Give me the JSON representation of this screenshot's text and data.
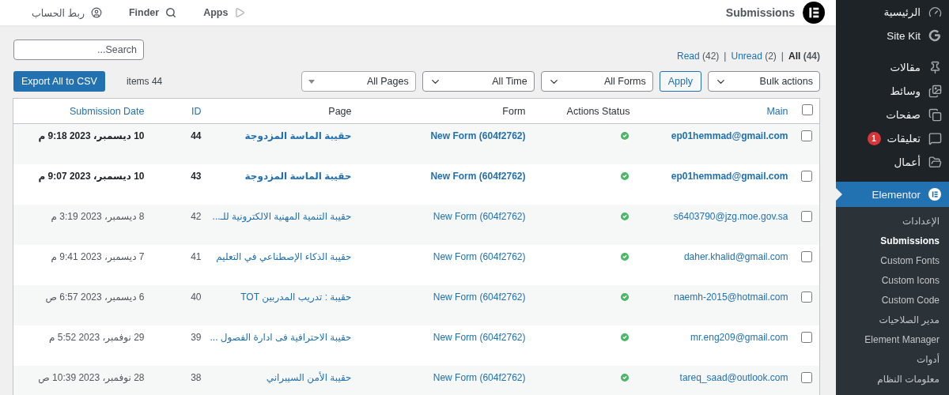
{
  "topbar": {
    "title": "Submissions",
    "links": [
      {
        "label": "Apps"
      },
      {
        "label": "Finder"
      },
      {
        "label": "ربط الحساب"
      }
    ]
  },
  "search": {
    "placeholder": "Search..."
  },
  "views": [
    {
      "label": "All",
      "count": "(44)",
      "selected": true
    },
    {
      "separator": "|",
      "label": "Unread",
      "count": "(2)",
      "selected": false
    },
    {
      "separator": "|",
      "label": "Read",
      "count": "(42)",
      "selected": false
    }
  ],
  "toolbar": {
    "filters": [
      {
        "label": "Bulk actions",
        "kind": "select"
      },
      {
        "label": "All Forms",
        "kind": "select"
      },
      {
        "label": "All Time",
        "kind": "select"
      },
      {
        "label": "All Pages",
        "kind": "combo"
      }
    ],
    "apply": "Apply",
    "items_count": "items 44",
    "export": "Export All to CSV"
  },
  "table": {
    "header_checked": false,
    "columns": [
      {
        "label": "Main",
        "sortable": true
      },
      {
        "label": "Actions Status",
        "sortable": false
      },
      {
        "label": "Form",
        "sortable": false
      },
      {
        "label": "Page",
        "sortable": false
      },
      {
        "label": "ID",
        "sortable": true
      },
      {
        "label": "Submission Date",
        "sortable": true
      }
    ],
    "rows": [
      {
        "checked": false,
        "unread": true,
        "main": "ep01hemmad@gmail.com",
        "status_ok": true,
        "form": "New Form (604f2762)",
        "page": "حقيبة الماسة المزدوجة",
        "id": "44",
        "date": "10 ديسمبر، 2023 9:18 م"
      },
      {
        "checked": false,
        "unread": true,
        "main": "ep01hemmad@gmail.com",
        "status_ok": true,
        "form": "New Form (604f2762)",
        "page": "حقيبة الماسة المزدوجة",
        "id": "43",
        "date": "10 ديسمبر، 2023 9:07 م"
      },
      {
        "checked": false,
        "unread": false,
        "main": "s6403790@jzg.moe.gov.sa",
        "status_ok": true,
        "form": "New Form (604f2762)",
        "page": "حقيبة التنمية المهنية الالكترونية للـ...",
        "id": "42",
        "date": "8 ديسمبر، 2023 3:19 م"
      },
      {
        "checked": false,
        "unread": false,
        "main": "daher.khalid@gmail.com",
        "status_ok": true,
        "form": "New Form (604f2762)",
        "page": "حقيبة الذكاء الإصطناعي في التعليم",
        "id": "41",
        "date": "7 ديسمبر، 2023 9:41 م"
      },
      {
        "checked": false,
        "unread": false,
        "main": "naemh-2015@hotmail.com",
        "status_ok": true,
        "form": "New Form (604f2762)",
        "page": "حقيبة : تدريب المدربين TOT",
        "id": "40",
        "date": "6 ديسمبر، 2023 6:57 ص"
      },
      {
        "checked": false,
        "unread": false,
        "main": "mr.eng209@gmail.com",
        "status_ok": true,
        "form": "New Form (604f2762)",
        "page": "حقيبة الاحترافية فى ادارة الفصول ...",
        "id": "39",
        "date": "29 نوفمبر، 2023 5:52 م"
      },
      {
        "checked": false,
        "unread": false,
        "main": "tareq_saad@outlook.com",
        "status_ok": true,
        "form": "New Form (604f2762)",
        "page": "حقيبة الأمن السيبراني",
        "id": "38",
        "date": "28 نوفمبر، 2023 10:39 ص"
      }
    ]
  },
  "sidebar": {
    "groups": [
      {
        "items": [
          {
            "label": "الرئيسية",
            "selected": false
          },
          {
            "label": "Site Kit",
            "selected": false
          }
        ]
      },
      {
        "items": [
          {
            "label": "مقالات",
            "selected": false
          },
          {
            "label": "وسائط",
            "selected": false
          },
          {
            "label": "صفحات",
            "selected": false
          },
          {
            "label": "تعليقات",
            "selected": false,
            "badge": "1"
          },
          {
            "label": "أعمال",
            "selected": false
          }
        ]
      },
      {
        "items": [
          {
            "label": "Elementor",
            "selected": true,
            "children": [
              {
                "label": "الإعدادات",
                "selected": false
              },
              {
                "label": "Submissions",
                "selected": true
              },
              {
                "label": "Custom Fonts",
                "selected": false
              },
              {
                "label": "Custom Icons",
                "selected": false
              },
              {
                "label": "Custom Code",
                "selected": false
              },
              {
                "label": "مدير الصلاحيات",
                "selected": false
              },
              {
                "label": "Element Manager",
                "selected": false
              },
              {
                "label": "أدوات",
                "selected": false
              },
              {
                "label": "معلومات النظام",
                "selected": false
              }
            ]
          }
        ]
      }
    ]
  }
}
